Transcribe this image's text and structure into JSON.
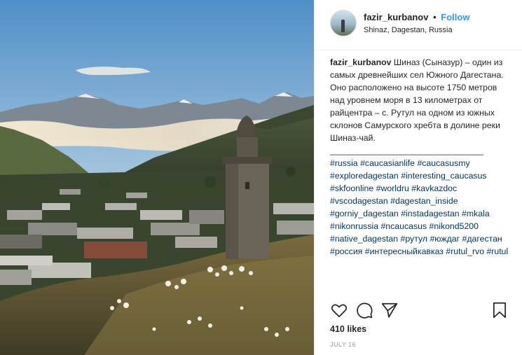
{
  "post": {
    "username": "fazir_kurbanov",
    "separator": "•",
    "follow_label": "Follow",
    "location": "Shinaz, Dagestan, Russia",
    "caption_text": "Шиназ (Сыназур) – один из самых древнейших сел Южного Дагестана. Оно расположено на высоте 1750 метров над уровнем моря в 13 километрах от райцентра – с. Рутул на одном из южных склонов Самурского хребта в долине реки Шиназ-чай.",
    "divider": "________________________________",
    "hashtags": [
      "#russia",
      "#caucasianlife",
      "#caucasusmy",
      "#exploredagestan",
      "#interesting_caucasus",
      "#skfoonline",
      "#worldru",
      "#kavkazdoc",
      "#vscodagestan",
      "#dagestan_inside",
      "#gorniy_dagestan",
      "#instadagestan",
      "#mkala",
      "#nikonrussia",
      "#ncaucasus",
      "#nikond5200",
      "#native_dagestan",
      "#рутул",
      "#юждаг",
      "#дагестан",
      "#россия",
      "#интересныйкавказ",
      "#rutul_rvo",
      "#rutul"
    ],
    "likes": "410 likes",
    "date": "JULY 16",
    "photo_alt": "Mountain village Shinaz with stone tower at sunrise"
  },
  "icons": {
    "like": "heart-icon",
    "comment": "comment-icon",
    "share": "share-icon",
    "save": "bookmark-icon"
  },
  "colors": {
    "link": "#003569",
    "follow": "#3897f0",
    "text": "#262626",
    "muted": "#999999"
  }
}
